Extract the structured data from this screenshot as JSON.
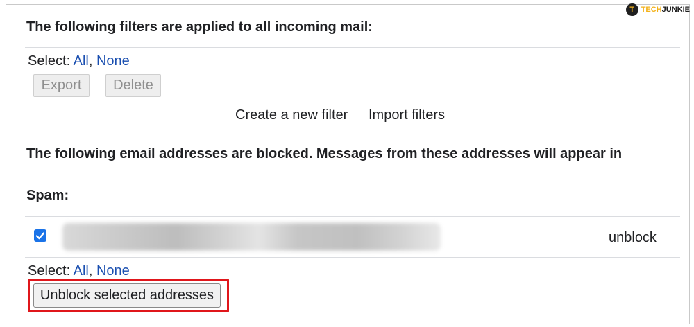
{
  "filters": {
    "heading": "The following filters are applied to all incoming mail:",
    "select_label": "Select:",
    "select_all": "All",
    "select_none": "None",
    "export_button": "Export",
    "delete_button": "Delete",
    "create_filter_link": "Create a new filter",
    "import_filters_link": "Import filters"
  },
  "blocked": {
    "heading_line1": "The following email addresses are blocked. Messages from these addresses will appear in",
    "heading_line2": "Spam:",
    "row": {
      "checked": true,
      "address_blurred": true,
      "unblock_link": "unblock"
    },
    "select_label": "Select:",
    "select_all": "All",
    "select_none": "None",
    "unblock_selected_button": "Unblock selected addresses"
  },
  "watermark": {
    "logo_letter": "T",
    "brand_part1": "TECH",
    "brand_part2": "JUNKIE"
  },
  "colors": {
    "link": "#1a4fb0",
    "highlight": "#e0161b",
    "checkbox": "#1a73e8"
  }
}
